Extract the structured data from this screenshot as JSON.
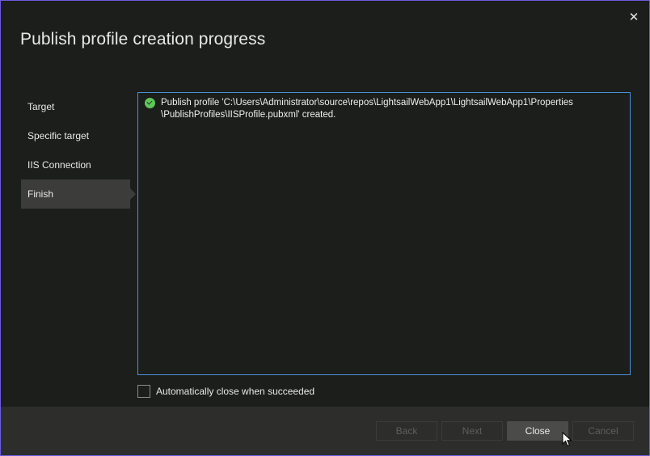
{
  "window": {
    "title": "Publish profile creation progress",
    "close_icon": "close-icon"
  },
  "steps": [
    {
      "label": "Target",
      "active": false
    },
    {
      "label": "Specific target",
      "active": false
    },
    {
      "label": "IIS Connection",
      "active": false
    },
    {
      "label": "Finish",
      "active": true
    }
  ],
  "log": {
    "entries": [
      {
        "icon": "success-check-icon",
        "text": "Publish profile 'C:\\Users\\Administrator\\source\\repos\\LightsailWebApp1\\LightsailWebApp1\\Properties\n\\PublishProfiles\\IISProfile.pubxml' created."
      }
    ]
  },
  "options": {
    "auto_close_label": "Automatically close when succeeded",
    "auto_close_checked": false
  },
  "footer": {
    "back_label": "Back",
    "next_label": "Next",
    "close_label": "Close",
    "cancel_label": "Cancel"
  },
  "colors": {
    "accent_border": "#4d90d8",
    "window_border": "#6b5ce0",
    "success": "#5fc65a",
    "background": "#1b1e1b",
    "footer_background": "#2d2e2c"
  }
}
